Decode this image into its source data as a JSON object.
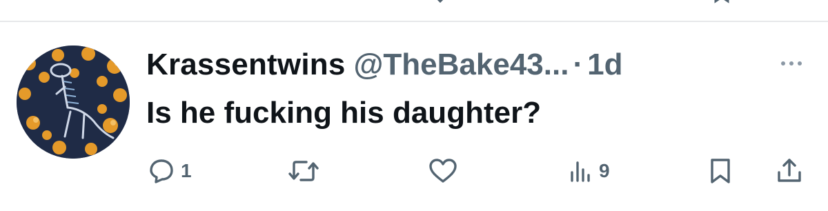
{
  "tweet": {
    "display_name": "Krassentwins",
    "handle": "@TheBake43...",
    "separator": "·",
    "timestamp": "1d",
    "text": "Is he fucking his daughter?",
    "avatar_description_icon": "dinosaur-skeleton-avatar"
  },
  "actions": {
    "reply_count": "1",
    "retweet_count": "",
    "like_count": "",
    "views_count": "9"
  },
  "colors": {
    "text_primary": "#0f1419",
    "text_secondary": "#536471",
    "divider": "#e6e8ea",
    "icon": "#536471"
  },
  "icons": {
    "reply": "reply-bubble-icon",
    "retweet": "retweet-icon",
    "like": "heart-icon",
    "views": "views-bar-icon",
    "bookmark": "bookmark-icon",
    "share": "share-icon",
    "more": "more-dots-icon"
  }
}
